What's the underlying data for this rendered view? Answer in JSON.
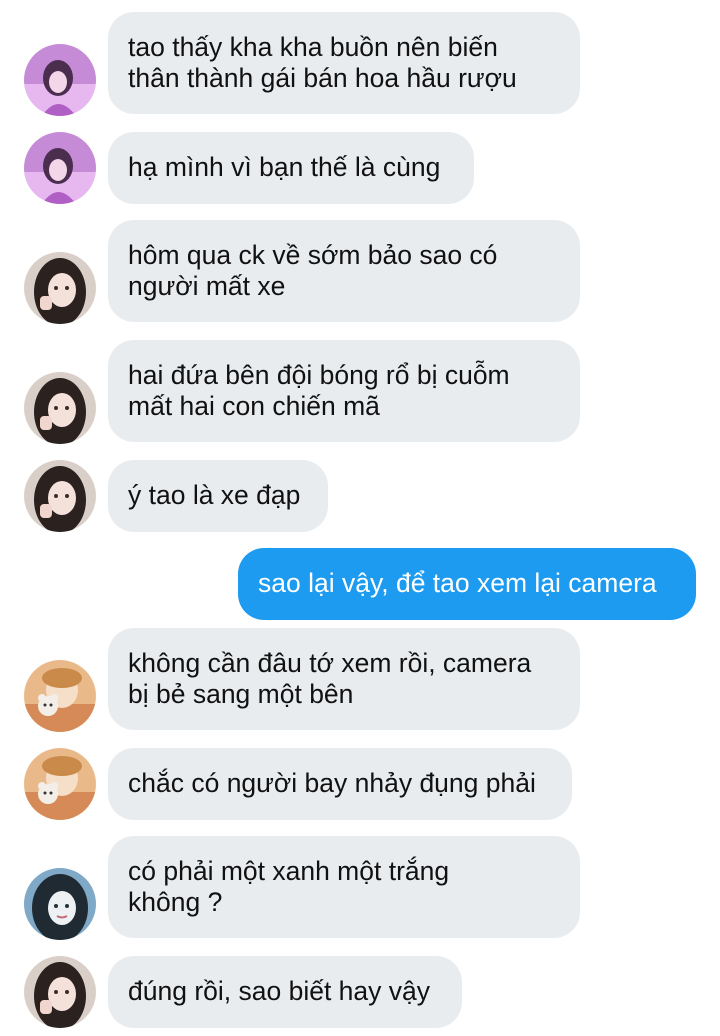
{
  "messages": [
    {
      "direction": "incoming",
      "avatar": "avatar-girl-purple",
      "text": "tao thấy kha kha buồn nên biến\nthân thành gái bán hoa hầu rượu"
    },
    {
      "direction": "incoming",
      "avatar": "avatar-girl-purple",
      "text": "hạ mình vì bạn thế là cùng"
    },
    {
      "direction": "incoming",
      "avatar": "avatar-girl-dark",
      "text": "hôm qua ck về sớm bảo sao có\nngười mất xe"
    },
    {
      "direction": "incoming",
      "avatar": "avatar-girl-dark",
      "text": "hai đứa bên đội bóng rổ bị cuỗm\nmất hai con chiến mã"
    },
    {
      "direction": "incoming",
      "avatar": "avatar-girl-dark",
      "text": "ý tao là xe đạp"
    },
    {
      "direction": "outgoing",
      "avatar": "",
      "text": "sao lại vậy, để tao xem lại camera"
    },
    {
      "direction": "incoming",
      "avatar": "avatar-girl-bear",
      "text": "không cần đâu tớ xem rồi, camera\nbị bẻ sang một bên"
    },
    {
      "direction": "incoming",
      "avatar": "avatar-girl-bear",
      "text": "chắc có người bay nhảy đụng phải"
    },
    {
      "direction": "incoming",
      "avatar": "avatar-girl-blue",
      "text": "có phải một xanh một trắng\nkhông ?"
    },
    {
      "direction": "incoming",
      "avatar": "avatar-girl-dark",
      "text": "đúng rồi, sao biết hay vậy"
    }
  ],
  "colors": {
    "incoming_bubble": "#e9ecef",
    "outgoing_bubble": "#1d9bf0",
    "incoming_text": "#111111",
    "outgoing_text": "#ffffff"
  }
}
